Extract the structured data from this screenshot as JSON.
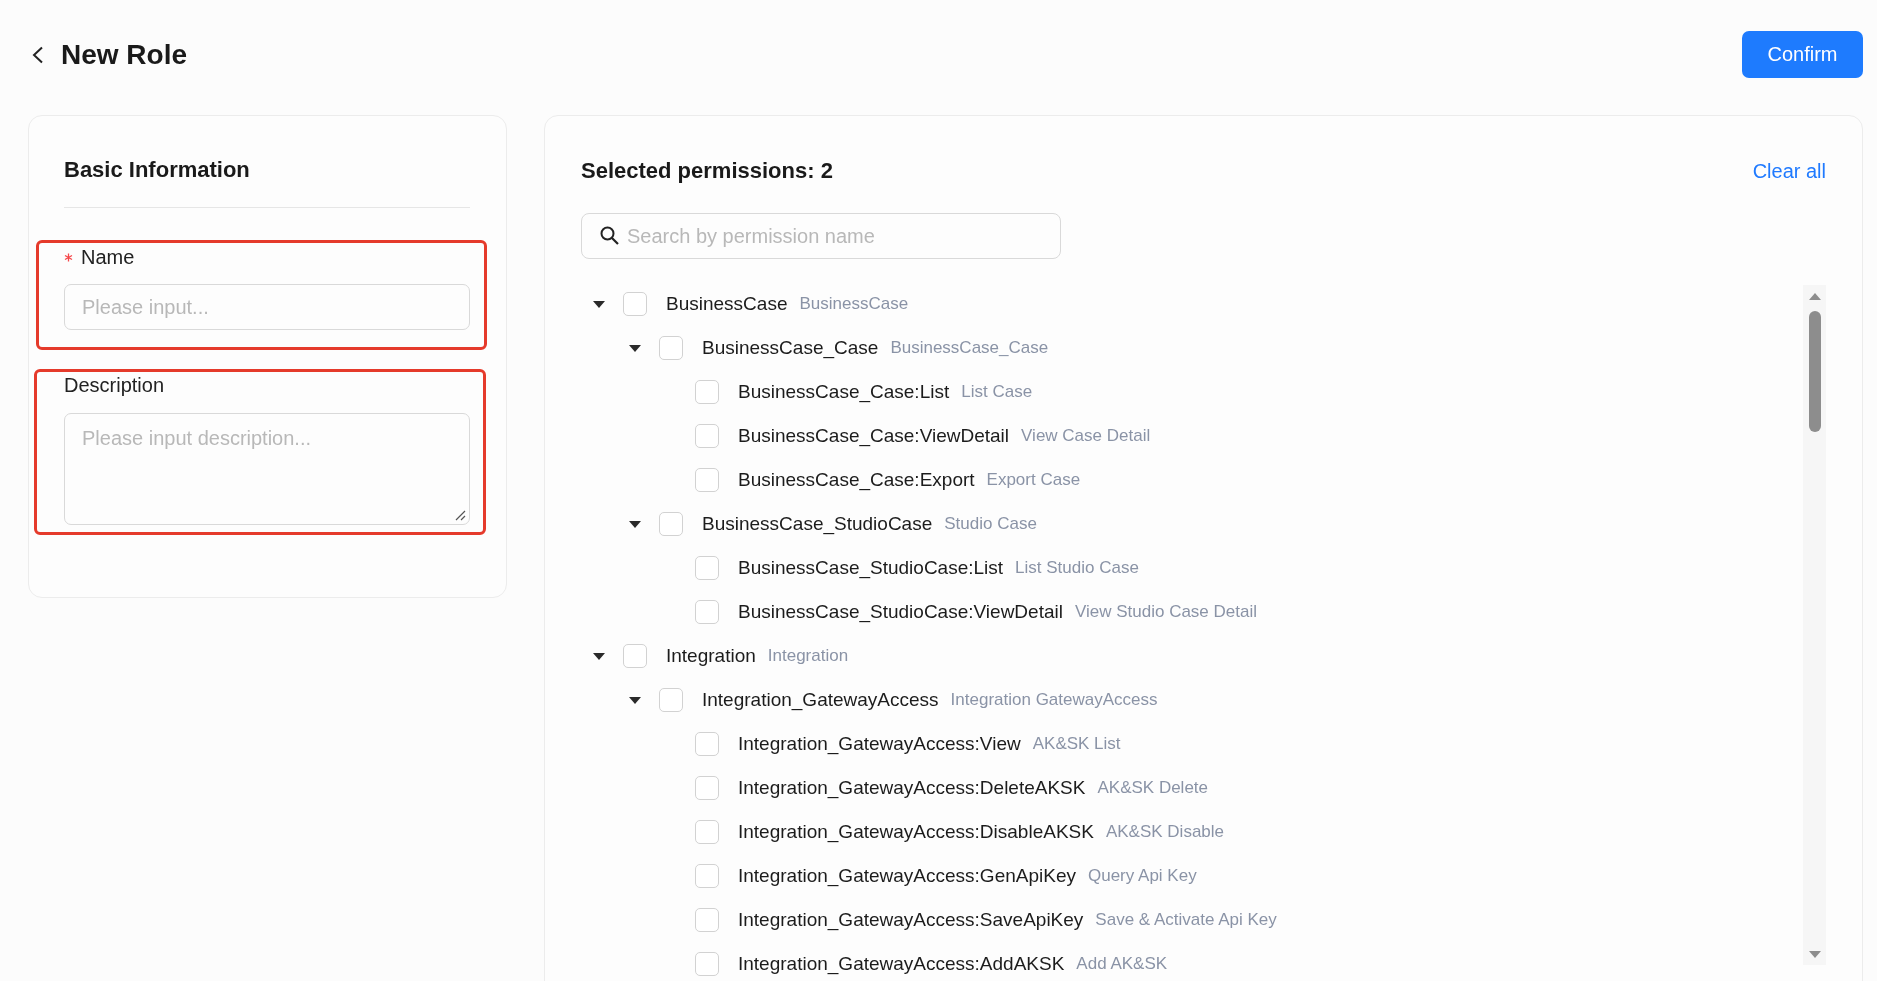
{
  "header": {
    "title": "New Role",
    "confirm_button": "Confirm"
  },
  "basic_info": {
    "title": "Basic Information",
    "fields": [
      {
        "kind": "input",
        "label": "Name",
        "required": true,
        "placeholder": "Please input...",
        "highlighted": true
      },
      {
        "kind": "textarea",
        "label": "Description",
        "required": false,
        "placeholder": "Please input description...",
        "highlighted": true
      }
    ]
  },
  "permissions": {
    "title": "Selected permissions: 2",
    "clear_all": "Clear all",
    "search": {
      "placeholder": "Search by permission name"
    },
    "tree": [
      {
        "name": "BusinessCase",
        "description": "BusinessCase",
        "checked": false,
        "expanded": true,
        "children": [
          {
            "name": "BusinessCase_Case",
            "description": "BusinessCase_Case",
            "checked": false,
            "expanded": true,
            "children": [
              {
                "name": "BusinessCase_Case:List",
                "description": "List Case",
                "checked": false
              },
              {
                "name": "BusinessCase_Case:ViewDetail",
                "description": "View Case Detail",
                "checked": false
              },
              {
                "name": "BusinessCase_Case:Export",
                "description": "Export Case",
                "checked": false
              }
            ]
          },
          {
            "name": "BusinessCase_StudioCase",
            "description": "Studio Case",
            "checked": false,
            "expanded": true,
            "children": [
              {
                "name": "BusinessCase_StudioCase:List",
                "description": "List Studio Case",
                "checked": false
              },
              {
                "name": "BusinessCase_StudioCase:ViewDetail",
                "description": "View Studio Case Detail",
                "checked": false
              }
            ]
          }
        ]
      },
      {
        "name": "Integration",
        "description": "Integration",
        "checked": false,
        "expanded": true,
        "children": [
          {
            "name": "Integration_GatewayAccess",
            "description": "Integration GatewayAccess",
            "checked": false,
            "expanded": true,
            "children": [
              {
                "name": "Integration_GatewayAccess:View",
                "description": "AK&SK List",
                "checked": false
              },
              {
                "name": "Integration_GatewayAccess:DeleteAKSK",
                "description": "AK&SK Delete",
                "checked": false
              },
              {
                "name": "Integration_GatewayAccess:DisableAKSK",
                "description": "AK&SK Disable",
                "checked": false
              },
              {
                "name": "Integration_GatewayAccess:GenApiKey",
                "description": "Query Api Key",
                "checked": false
              },
              {
                "name": "Integration_GatewayAccess:SaveApiKey",
                "description": "Save & Activate Api Key",
                "checked": false
              },
              {
                "name": "Integration_GatewayAccess:AddAKSK",
                "description": "Add AK&SK",
                "checked": false
              }
            ]
          }
        ]
      }
    ]
  }
}
